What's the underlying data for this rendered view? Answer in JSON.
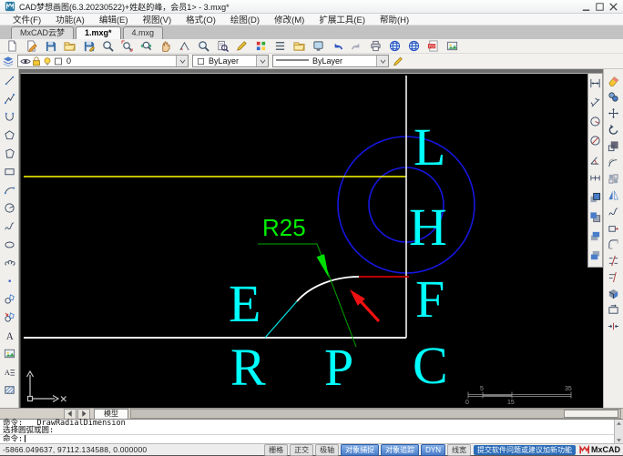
{
  "window": {
    "title": "CAD梦想画图(6.3.20230522)+姓赵的峰，会员1> - 3.mxg*",
    "control_icons": [
      "minimize-icon",
      "maximize-icon",
      "close-icon"
    ]
  },
  "menubar": {
    "items": [
      "文件(F)",
      "功能(A)",
      "编辑(E)",
      "视图(V)",
      "格式(O)",
      "绘图(D)",
      "修改(M)",
      "扩展工具(E)",
      "帮助(H)"
    ]
  },
  "doc_tabs": {
    "tabs": [
      {
        "label": "MxCAD云梦",
        "active": false
      },
      {
        "label": "1.mxg*",
        "active": true
      },
      {
        "label": "4.mxg",
        "active": false
      }
    ]
  },
  "toolbar": {
    "icons": [
      "new-file-icon",
      "sketch-icon",
      "save-icon",
      "open-icon",
      "save-as-icon",
      "zoom-extents-icon",
      "zoom-window-icon",
      "zoom-dynamic-icon",
      "pan-icon",
      "measure-angle-icon",
      "zoom-object-icon",
      "find-icon",
      "draw-pencil-icon",
      "color-palette-icon",
      "linetype-list-icon",
      "folder-manage-icon",
      "display-settings-icon",
      "undo-icon",
      "redo-icon",
      "print-icon",
      "web-icon",
      "web-publish-icon",
      "pdf-export-icon",
      "image-export-icon"
    ]
  },
  "properties_bar": {
    "layers_icon": [
      "layers-icon"
    ],
    "layer_mini_icons": [
      "visibility-icon",
      "lock-icon",
      "bulb-icon",
      "layer-swatch-icon"
    ],
    "layer_value": "0",
    "color_value": "ByLayer",
    "linetype_value": "ByLayer",
    "edit_icon": [
      "pencil-edit-icon"
    ]
  },
  "left_toolbar": {
    "tools": [
      "line-icon",
      "polyline-icon",
      "arc-icon",
      "polygon-icon",
      "polygon2-icon",
      "rectangle-icon",
      "arc-3point-icon",
      "circle-icon",
      "spline-icon",
      "ellipse-icon",
      "revcloud-icon",
      "point-icon",
      "block-icon",
      "insert-block-icon",
      "text-icon",
      "image-icon",
      "mtext-icon",
      "hatch-icon"
    ]
  },
  "dim_toolbar": {
    "tools": [
      "dim-linear-icon",
      "dim-aligned-icon",
      "dim-radius-icon",
      "dim-diameter-icon",
      "dim-angular-icon",
      "dim-continue-icon",
      "draworder-front-icon",
      "draworder-back-icon",
      "draworder-above-icon",
      "draworder-below-icon"
    ]
  },
  "modify_toolbar": {
    "tools": [
      "erase-icon",
      "copy-icon",
      "move-icon",
      "rotate-icon",
      "scale-icon",
      "offset-icon",
      "array-icon",
      "mirror-icon",
      "spline-edit-icon",
      "stretch-icon",
      "fillet-icon",
      "trim-icon",
      "extend-icon",
      "explode-icon",
      "boundary-icon",
      "join-icon"
    ]
  },
  "canvas": {
    "dimension_label": "R25",
    "letters": [
      "L",
      "H",
      "F",
      "E",
      "R",
      "P",
      "C"
    ],
    "scale_bar": {
      "top_labels": [
        "5",
        "35"
      ],
      "bottom_labels": [
        "0",
        "15"
      ]
    },
    "colors": {
      "background": "#000000",
      "circles": "#1616e0",
      "letters": "#00ffff",
      "construction_line": "#ffff00",
      "outline": "#f2f2f2",
      "dimension": "#00f000",
      "highlight_segment": "#d40000",
      "annotation_arrow": "#ee1111"
    }
  },
  "model_tabs": {
    "nav_icons": [
      "tab-prev-icon",
      "tab-next-icon"
    ],
    "label": "模型"
  },
  "command": {
    "lines": [
      "命令:  _DrawRadialDimension",
      "选择圆弧或圆:"
    ],
    "prompt": "命令:",
    "scroll_icons": [
      "scroll-up-icon",
      "scroll-down-icon"
    ]
  },
  "statusbar": {
    "coordinates": "-5866.049637, 97112.134588,  0.000000",
    "toggles": [
      {
        "label": "栅格",
        "active": false
      },
      {
        "label": "正交",
        "active": false
      },
      {
        "label": "极轴",
        "active": false
      },
      {
        "label": "对象捕捉",
        "active": true
      },
      {
        "label": "对象追踪",
        "active": true
      },
      {
        "label": "DYN",
        "active": true
      },
      {
        "label": "线宽",
        "active": false
      }
    ],
    "feedback_label": "提交软件问题或建议加新功能",
    "logo_text": "MxCAD"
  }
}
